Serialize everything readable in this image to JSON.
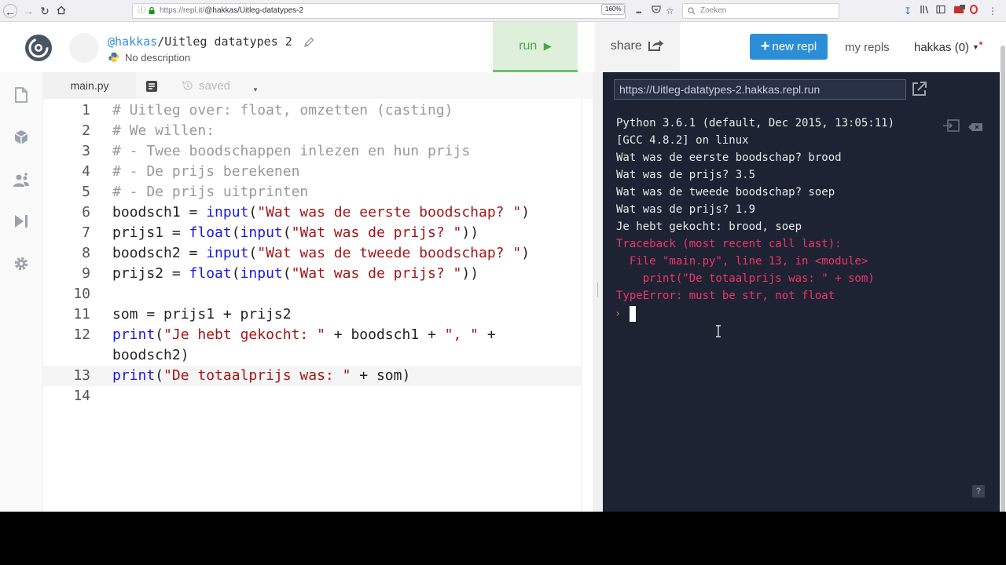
{
  "browser": {
    "url_prefix": "https://repl.it/",
    "url_path": "@hakkas/Uitleg-datatypes-2",
    "zoom": "160%",
    "search_placeholder": "Zoeken",
    "more_icon": "•••"
  },
  "header": {
    "owner": "@hakkas",
    "separator": "/",
    "repl_name": "Uitleg datatypes 2",
    "description": "No description",
    "run_label": "run",
    "share_label": "share",
    "new_repl_label": "new repl",
    "my_repls_label": "my repls",
    "user_label": "hakkas (0)"
  },
  "editor": {
    "tab_label": "main.py",
    "saved_label": "saved",
    "active_line": 13,
    "lines": [
      [
        {
          "t": "# Uitleg over: float, omzetten (casting)",
          "k": "c"
        }
      ],
      [
        {
          "t": "# We willen:",
          "k": "c"
        }
      ],
      [
        {
          "t": "# - Twee boodschappen inlezen en hun prijs",
          "k": "c"
        }
      ],
      [
        {
          "t": "# - De prijs berekenen",
          "k": "c"
        }
      ],
      [
        {
          "t": "# - De prijs uitprinten",
          "k": "c"
        }
      ],
      [
        {
          "t": "boodsch1 = "
        },
        {
          "t": "input",
          "k": "k"
        },
        {
          "t": "("
        },
        {
          "t": "\"Wat was de eerste boodschap? \"",
          "k": "s"
        },
        {
          "t": ")"
        }
      ],
      [
        {
          "t": "prijs1 = "
        },
        {
          "t": "float",
          "k": "k"
        },
        {
          "t": "("
        },
        {
          "t": "input",
          "k": "k"
        },
        {
          "t": "("
        },
        {
          "t": "\"Wat was de prijs? \"",
          "k": "s"
        },
        {
          "t": "))"
        }
      ],
      [
        {
          "t": "boodsch2 = "
        },
        {
          "t": "input",
          "k": "k"
        },
        {
          "t": "("
        },
        {
          "t": "\"Wat was de tweede boodschap? \"",
          "k": "s"
        },
        {
          "t": ")"
        }
      ],
      [
        {
          "t": "prijs2 = "
        },
        {
          "t": "float",
          "k": "k"
        },
        {
          "t": "("
        },
        {
          "t": "input",
          "k": "k"
        },
        {
          "t": "("
        },
        {
          "t": "\"Wat was de prijs? \"",
          "k": "s"
        },
        {
          "t": "))"
        }
      ],
      [],
      [
        {
          "t": "som = prijs1 + prijs2"
        }
      ],
      [
        {
          "t": "print",
          "k": "k"
        },
        {
          "t": "("
        },
        {
          "t": "\"Je hebt gekocht: \"",
          "k": "s"
        },
        {
          "t": " + boodsch1 + "
        },
        {
          "t": "\", \"",
          "k": "s"
        },
        {
          "t": " +"
        }
      ],
      [
        {
          "t": "print",
          "k": "k"
        },
        {
          "t": "("
        },
        {
          "t": "\"De totaalprijs was: \"",
          "k": "s"
        },
        {
          "t": " + som)"
        }
      ],
      []
    ],
    "wrap_line_12": "boodsch2)"
  },
  "console": {
    "url": "https://Uitleg-datatypes-2.hakkas.repl.run",
    "output": [
      {
        "text": "Python 3.6.1 (default, Dec 2015, 13:05:11)",
        "error": false
      },
      {
        "text": "[GCC 4.8.2] on linux",
        "error": false
      },
      {
        "text": "Wat was de eerste boodschap? brood",
        "error": false
      },
      {
        "text": "Wat was de prijs? 3.5",
        "error": false
      },
      {
        "text": "Wat was de tweede boodschap? soep",
        "error": false
      },
      {
        "text": "Wat was de prijs? 1.9",
        "error": false
      },
      {
        "text": "Je hebt gekocht: brood, soep",
        "error": false
      },
      {
        "text": "Traceback (most recent call last):",
        "error": true
      },
      {
        "text": "  File \"main.py\", line 13, in <module>",
        "error": true
      },
      {
        "text": "    print(\"De totaalprijs was: \" + som)",
        "error": true
      },
      {
        "text": "TypeError: must be str, not float",
        "error": true
      }
    ],
    "prompt": "›",
    "help_label": "?"
  }
}
